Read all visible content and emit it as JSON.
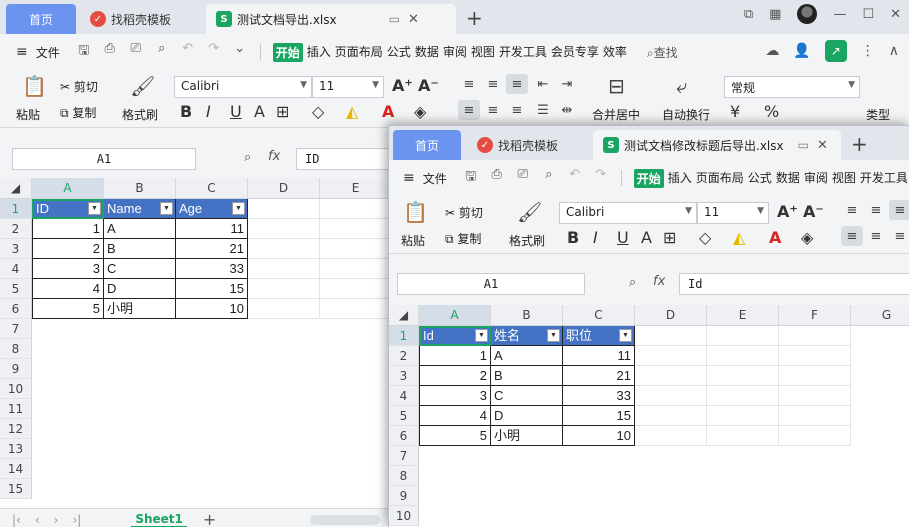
{
  "back": {
    "tabs": {
      "home": "首页",
      "template": "找稻壳模板",
      "file": "测试文档导出.xlsx"
    },
    "menu": {
      "file": "文件",
      "ribbon_tabs": [
        "开始",
        "插入",
        "页面布局",
        "公式",
        "数据",
        "审阅",
        "视图",
        "开发工具",
        "会员专享",
        "效率"
      ],
      "search": "查找"
    },
    "ribbon": {
      "paste": "粘贴",
      "cut": "剪切",
      "copy": "复制",
      "format_painter": "格式刷",
      "font": "Calibri",
      "size": "11",
      "number_format": "常规",
      "merge": "合并居中",
      "wrap": "自动换行",
      "type": "类型"
    },
    "namebox": "A1",
    "formula": "ID",
    "columns": [
      "A",
      "B",
      "C",
      "D",
      "E"
    ],
    "rows": [
      "1",
      "2",
      "3",
      "4",
      "5",
      "6",
      "7",
      "8",
      "9",
      "10",
      "11",
      "12",
      "13",
      "14",
      "15"
    ],
    "table": {
      "header": [
        "ID",
        "Name",
        "Age"
      ],
      "data": [
        [
          "1",
          "A",
          "11"
        ],
        [
          "2",
          "B",
          "21"
        ],
        [
          "3",
          "C",
          "33"
        ],
        [
          "4",
          "D",
          "15"
        ],
        [
          "5",
          "小明",
          "10"
        ]
      ]
    },
    "sheet": "Sheet1"
  },
  "front": {
    "tabs": {
      "home": "首页",
      "template": "找稻壳模板",
      "file": "测试文档修改标题后导出.xlsx"
    },
    "menu": {
      "file": "文件",
      "ribbon_tabs": [
        "开始",
        "插入",
        "页面布局",
        "公式",
        "数据",
        "审阅",
        "视图",
        "开发工具"
      ]
    },
    "ribbon": {
      "paste": "粘贴",
      "cut": "剪切",
      "copy": "复制",
      "format_painter": "格式刷",
      "font": "Calibri",
      "size": "11"
    },
    "namebox": "A1",
    "formula": "Id",
    "columns": [
      "A",
      "B",
      "C",
      "D",
      "E",
      "F",
      "G"
    ],
    "rows": [
      "1",
      "2",
      "3",
      "4",
      "5",
      "6",
      "7",
      "8",
      "9",
      "10"
    ],
    "table": {
      "header": [
        "Id",
        "姓名",
        "职位"
      ],
      "data": [
        [
          "1",
          "A",
          "11"
        ],
        [
          "2",
          "B",
          "21"
        ],
        [
          "3",
          "C",
          "33"
        ],
        [
          "4",
          "D",
          "15"
        ],
        [
          "5",
          "小明",
          "10"
        ]
      ]
    }
  }
}
